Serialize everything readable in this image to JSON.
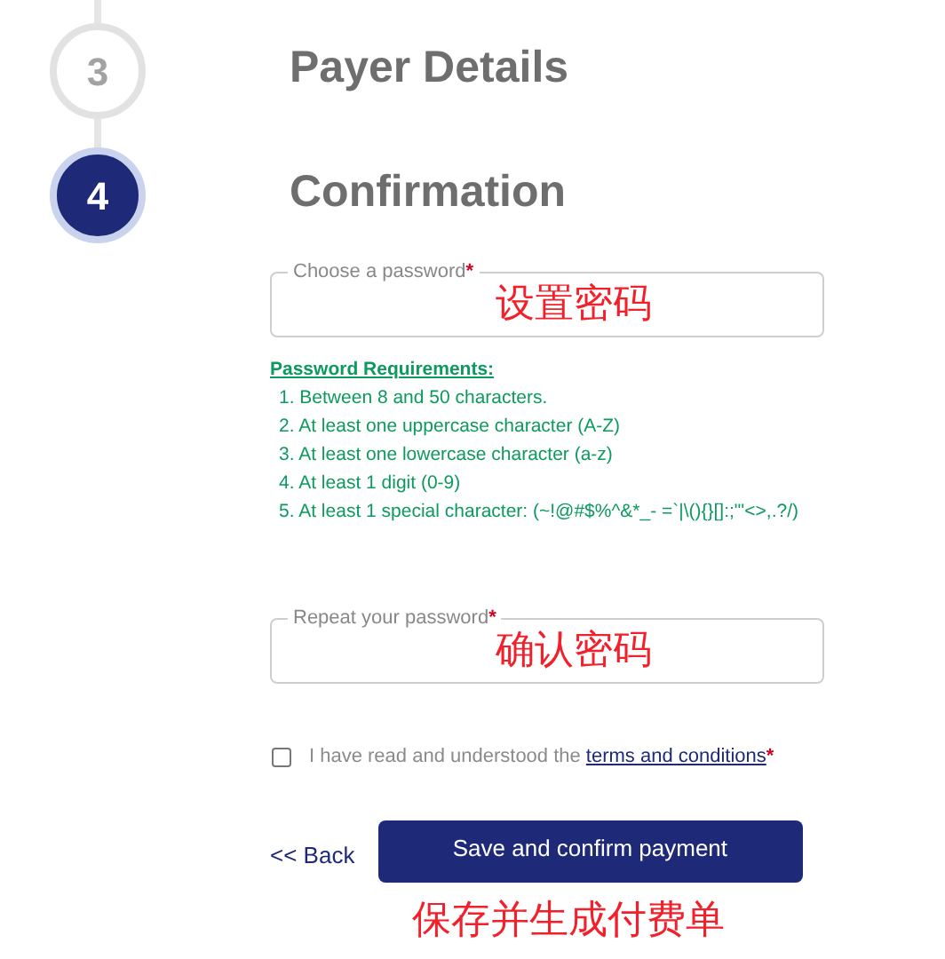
{
  "steps": [
    {
      "number": "3",
      "title": "Payer Details",
      "selected": false
    },
    {
      "number": "4",
      "title": "Confirmation",
      "selected": true
    }
  ],
  "password_field": {
    "label": "Choose a password",
    "required_mark": "*",
    "annotation": "设置密码"
  },
  "requirements": {
    "title": "Password Requirements:",
    "items": [
      "1. Between 8 and 50 characters.",
      "2. At least one uppercase character (A-Z)",
      "3. At least one lowercase character (a-z)",
      "4. At least 1 digit (0-9)",
      "5. At least 1 special character: (~!@#$%^&*_- =`|\\(){}[]:;\"'<>,.?/)"
    ]
  },
  "repeat_field": {
    "label": "Repeat your password",
    "required_mark": "*",
    "annotation": "确认密码"
  },
  "terms": {
    "checked": false,
    "text": "I have read and understood the",
    "link": "terms and conditions",
    "required_mark": "*"
  },
  "back_link": "<< Back",
  "submit_button": "Save and confirm payment",
  "submit_annotation": "保存并生成付费单"
}
